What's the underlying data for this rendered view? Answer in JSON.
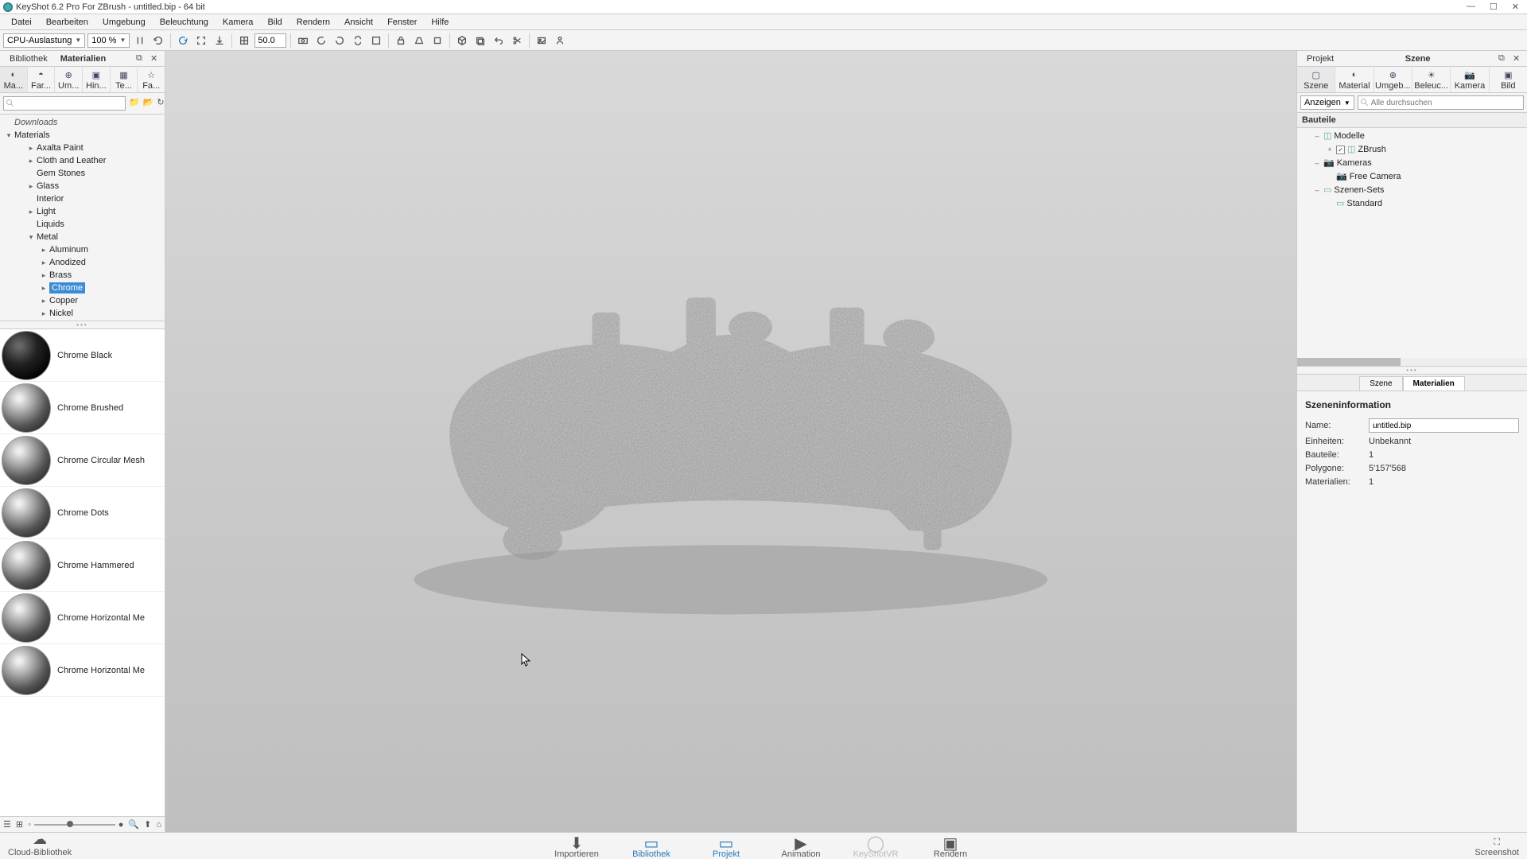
{
  "window": {
    "title": "KeyShot 6.2 Pro For ZBrush - untitled.bip - 64 bit"
  },
  "menu": [
    "Datei",
    "Bearbeiten",
    "Umgebung",
    "Beleuchtung",
    "Kamera",
    "Bild",
    "Rendern",
    "Ansicht",
    "Fenster",
    "Hilfe"
  ],
  "toolbar": {
    "cpu_label": "CPU-Auslastung",
    "cpu_value": "100 %",
    "num_value": "50.0"
  },
  "left": {
    "tabs": {
      "lib": "Bibliothek",
      "mat": "Materialien"
    },
    "cats": [
      "Ma...",
      "Far...",
      "Um...",
      "Hin...",
      "Te...",
      "Fa..."
    ],
    "search_placeholder": "",
    "tree": {
      "downloads": "Downloads",
      "materials": "Materials",
      "items": [
        {
          "label": "Axalta Paint",
          "depth": 2,
          "tw": "▸"
        },
        {
          "label": "Cloth and Leather",
          "depth": 2,
          "tw": "▸"
        },
        {
          "label": "Gem Stones",
          "depth": 2,
          "tw": ""
        },
        {
          "label": "Glass",
          "depth": 2,
          "tw": "▸"
        },
        {
          "label": "Interior",
          "depth": 2,
          "tw": ""
        },
        {
          "label": "Light",
          "depth": 2,
          "tw": "▸"
        },
        {
          "label": "Liquids",
          "depth": 2,
          "tw": ""
        },
        {
          "label": "Metal",
          "depth": 2,
          "tw": "▾",
          "open": true
        },
        {
          "label": "Aluminum",
          "depth": 3,
          "tw": "▸"
        },
        {
          "label": "Anodized",
          "depth": 3,
          "tw": "▸"
        },
        {
          "label": "Brass",
          "depth": 3,
          "tw": "▸"
        },
        {
          "label": "Chrome",
          "depth": 3,
          "tw": "▸",
          "sel": true
        },
        {
          "label": "Copper",
          "depth": 3,
          "tw": "▸"
        },
        {
          "label": "Nickel",
          "depth": 3,
          "tw": "▸"
        }
      ]
    },
    "thumbs": [
      {
        "label": "Chrome Black",
        "variant": "black"
      },
      {
        "label": "Chrome Brushed",
        "variant": ""
      },
      {
        "label": "Chrome Circular Mesh",
        "variant": ""
      },
      {
        "label": "Chrome Dots",
        "variant": ""
      },
      {
        "label": "Chrome Hammered",
        "variant": ""
      },
      {
        "label": "Chrome Horizontal Me",
        "variant": ""
      },
      {
        "label": "Chrome Horizontal Me",
        "variant": ""
      }
    ],
    "cloud_label": "Cloud-Bibliothek"
  },
  "right": {
    "tabs": {
      "proj": "Projekt",
      "scene": "Szene"
    },
    "cats": [
      "Szene",
      "Material",
      "Umgeb...",
      "Beleuc...",
      "Kamera",
      "Bild"
    ],
    "filter": {
      "show": "Anzeigen",
      "search_placeholder": "Alle durchsuchen"
    },
    "section": "Bauteile",
    "tree": [
      {
        "label": "Modelle",
        "depth": 1,
        "tw": "–",
        "icon": "cube"
      },
      {
        "label": "ZBrush",
        "depth": 2,
        "tw": "+",
        "cb": true,
        "icon": "cube"
      },
      {
        "label": "Kameras",
        "depth": 1,
        "tw": "–",
        "icon": "cam"
      },
      {
        "label": "Free Camera",
        "depth": 2,
        "tw": "",
        "icon": "cam"
      },
      {
        "label": "Szenen-Sets",
        "depth": 1,
        "tw": "–",
        "icon": "set"
      },
      {
        "label": "Standard",
        "depth": 2,
        "tw": "",
        "icon": "set"
      }
    ],
    "subtabs": {
      "scene": "Szene",
      "mat": "Materialien"
    },
    "info": {
      "title": "Szeneninformation",
      "name_k": "Name:",
      "name_v": "untitled.bip",
      "units_k": "Einheiten:",
      "units_v": "Unbekannt",
      "parts_k": "Bauteile:",
      "parts_v": "1",
      "polys_k": "Polygone:",
      "polys_v": "5'157'568",
      "mats_k": "Materialien:",
      "mats_v": "1"
    }
  },
  "bottom": {
    "items": [
      {
        "label": "Importieren",
        "icon": "⬇"
      },
      {
        "label": "Bibliothek",
        "icon": "▭",
        "active": true
      },
      {
        "label": "Projekt",
        "icon": "▭",
        "active": true
      },
      {
        "label": "Animation",
        "icon": "▶"
      },
      {
        "label": "KeyShotVR",
        "icon": "◯",
        "disabled": true
      },
      {
        "label": "Rendern",
        "icon": "▣"
      }
    ],
    "screenshot": "Screenshot"
  }
}
